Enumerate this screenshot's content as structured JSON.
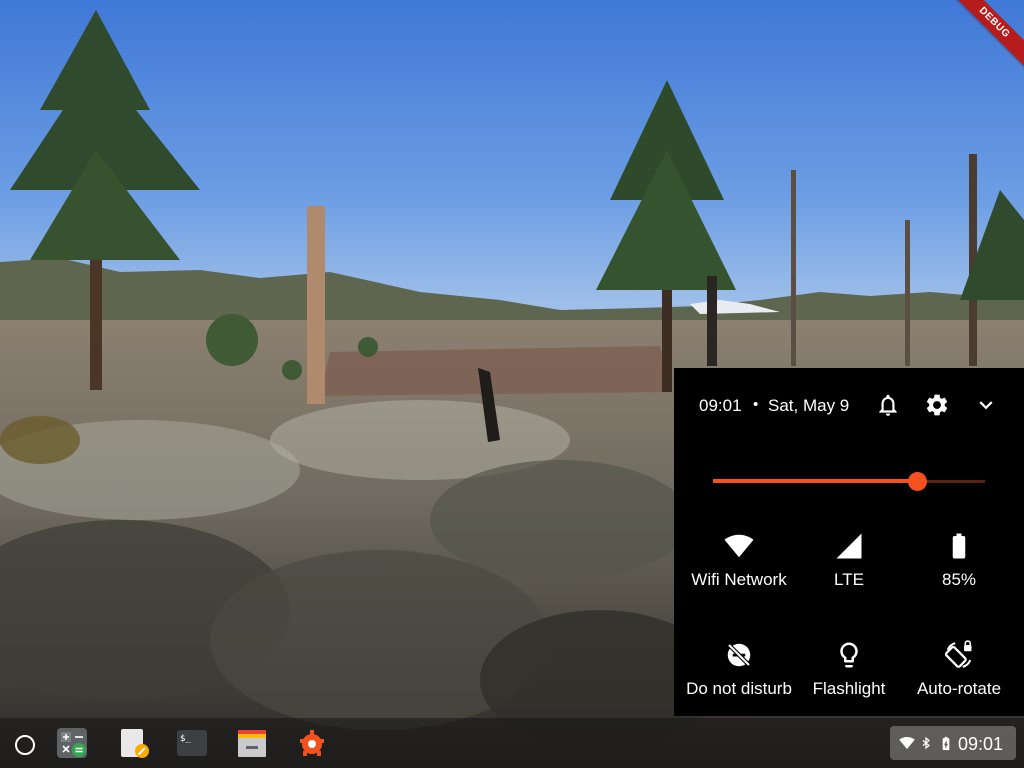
{
  "debug_banner": "DEBUG",
  "quick_settings": {
    "time": "09:01",
    "separator": "•",
    "date": "Sat, May 9",
    "icons": [
      "bell-icon",
      "gear-icon",
      "chevron-down-icon"
    ],
    "brightness_level": 0.75,
    "accent_color": "#f4511e",
    "tiles": [
      {
        "label": "Wifi Network",
        "icon": "wifi-icon"
      },
      {
        "label": "LTE",
        "icon": "cell-signal-icon"
      },
      {
        "label": "85%",
        "icon": "battery-icon"
      },
      {
        "label": "Do not disturb",
        "icon": "do-not-disturb-icon"
      },
      {
        "label": "Flashlight",
        "icon": "flashlight-icon"
      },
      {
        "label": "Auto-rotate",
        "icon": "auto-rotate-icon"
      }
    ]
  },
  "shelf": {
    "apps": [
      "calculator-icon",
      "text-editor-icon",
      "terminal-icon",
      "files-icon",
      "settings-app-icon"
    ],
    "status": {
      "icons": [
        "wifi-icon",
        "bluetooth-icon",
        "battery-charging-icon"
      ],
      "time": "09:01"
    }
  }
}
